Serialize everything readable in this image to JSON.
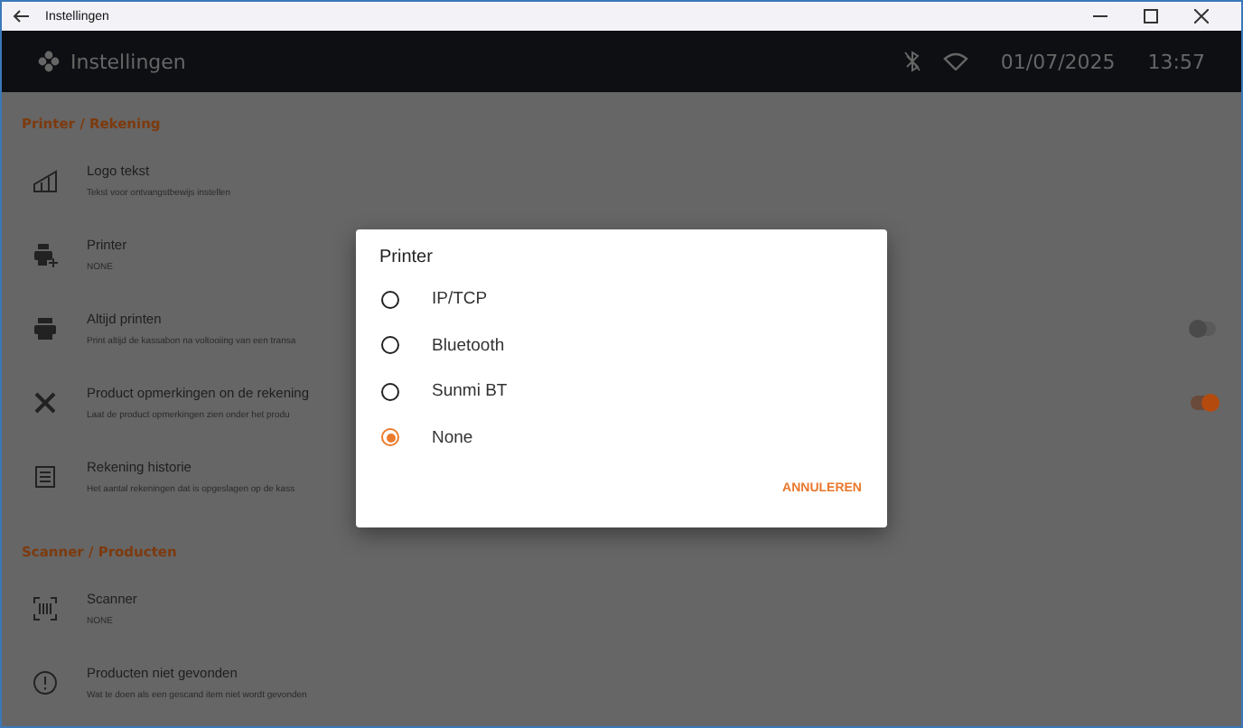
{
  "window": {
    "title": "Instellingen"
  },
  "header": {
    "title": "Instellingen",
    "date": "01/07/2025",
    "time": "13:57"
  },
  "sections": [
    {
      "title": "Printer / Rekening",
      "items": [
        {
          "title": "Logo tekst",
          "subtitle": "Tekst voor ontvangstbewijs instellen"
        },
        {
          "title": "Printer",
          "subtitle": "NONE"
        },
        {
          "title": "Altijd printen",
          "subtitle": "Print altijd de kassabon na voltooiing van een transa",
          "toggle": {
            "on": false
          }
        },
        {
          "title": "Product opmerkingen on de rekening",
          "subtitle": "Laat de product opmerkingen zien onder het produ",
          "toggle": {
            "on": true
          }
        },
        {
          "title": "Rekening historie",
          "subtitle": "Het aantal rekeningen dat is opgeslagen op de kass"
        }
      ]
    },
    {
      "title": "Scanner / Producten",
      "items": [
        {
          "title": "Scanner",
          "subtitle": "NONE"
        },
        {
          "title": "Producten niet gevonden",
          "subtitle": "Wat te doen als een gescand item niet wordt gevonden"
        }
      ]
    }
  ],
  "dialog": {
    "title": "Printer",
    "options": [
      {
        "label": "IP/TCP",
        "selected": false
      },
      {
        "label": "Bluetooth",
        "selected": false
      },
      {
        "label": "Sunmi BT",
        "selected": false
      },
      {
        "label": "None",
        "selected": true
      }
    ],
    "cancel": "ANNULEREN"
  }
}
